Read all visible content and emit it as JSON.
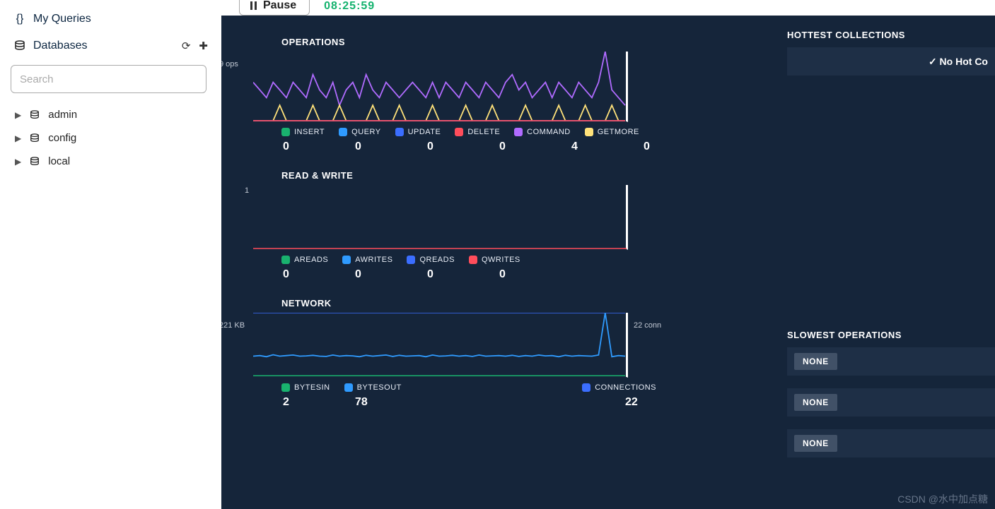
{
  "sidebar": {
    "my_queries": "My Queries",
    "databases": "Databases",
    "search_placeholder": "Search",
    "items": [
      "admin",
      "config",
      "local"
    ]
  },
  "toolbar": {
    "pause": "Pause",
    "timer": "08:25:59"
  },
  "colors": {
    "insert": "#19b26e",
    "query": "#2f9bff",
    "update": "#3b6eff",
    "delete": "#ff4d5b",
    "command": "#b06bff",
    "getmore": "#ffe27a",
    "areads": "#19b26e",
    "awrites": "#2f9bff",
    "qreads": "#3b6eff",
    "qwrites": "#ff4d5b",
    "bytesin": "#19b26e",
    "bytesout": "#2f9bff",
    "connections": "#3b6eff"
  },
  "charts": {
    "operations": {
      "title": "OPERATIONS",
      "y_label": "9 ops",
      "legend": [
        {
          "key": "insert",
          "label": "INSERT",
          "value": "0"
        },
        {
          "key": "query",
          "label": "QUERY",
          "value": "0"
        },
        {
          "key": "update",
          "label": "UPDATE",
          "value": "0"
        },
        {
          "key": "delete",
          "label": "DELETE",
          "value": "0"
        },
        {
          "key": "command",
          "label": "COMMAND",
          "value": "4"
        },
        {
          "key": "getmore",
          "label": "GETMORE",
          "value": "0"
        }
      ]
    },
    "readwrite": {
      "title": "READ & WRITE",
      "y_label": "1",
      "legend": [
        {
          "key": "areads",
          "label": "AREADS",
          "value": "0"
        },
        {
          "key": "awrites",
          "label": "AWRITES",
          "value": "0"
        },
        {
          "key": "qreads",
          "label": "QREADS",
          "value": "0"
        },
        {
          "key": "qwrites",
          "label": "QWRITES",
          "value": "0"
        }
      ]
    },
    "network": {
      "title": "NETWORK",
      "y_left": "221 KB",
      "y_right": "22 conn",
      "legend": [
        {
          "key": "bytesin",
          "label": "BYTESIN",
          "value": "2"
        },
        {
          "key": "bytesout",
          "label": "BYTESOUT",
          "value": "78"
        },
        {
          "key": "connections",
          "label": "CONNECTIONS",
          "value": "22"
        }
      ]
    }
  },
  "right": {
    "hottest_title": "HOTTEST COLLECTIONS",
    "no_hot": "✓ No Hot Co",
    "slowest_title": "SLOWEST OPERATIONS",
    "slow_items": [
      "NONE",
      "NONE",
      "NONE"
    ]
  },
  "watermark": "CSDN @水中加点糖",
  "chart_data": [
    {
      "type": "line",
      "title": "OPERATIONS",
      "ylabel": "ops",
      "ylim": [
        0,
        9
      ],
      "series": [
        {
          "name": "COMMAND",
          "values": [
            5,
            4,
            3,
            5,
            4,
            3,
            5,
            4,
            3,
            6,
            4,
            3,
            5,
            2,
            4,
            5,
            3,
            6,
            4,
            3,
            5,
            4,
            3,
            4,
            5,
            4,
            3,
            5,
            3,
            5,
            4,
            3,
            5,
            4,
            3,
            5,
            4,
            3,
            5,
            6,
            4,
            5,
            3,
            4,
            5,
            3,
            5,
            4,
            3,
            5,
            4,
            3,
            5,
            9,
            4,
            3,
            2
          ]
        },
        {
          "name": "GETMORE",
          "values": [
            0,
            0,
            0,
            0,
            1,
            0,
            0,
            0,
            0,
            1,
            0,
            0,
            0,
            1,
            0,
            0,
            0,
            0,
            1,
            0,
            0,
            0,
            1,
            0,
            0,
            0,
            0,
            1,
            0,
            0,
            0,
            0,
            1,
            0,
            0,
            0,
            1,
            0,
            0,
            0,
            0,
            1,
            0,
            0,
            0,
            0,
            1,
            0,
            0,
            0,
            1,
            0,
            0,
            0,
            1,
            0,
            0
          ]
        },
        {
          "name": "INSERT",
          "values": [
            0,
            0,
            0,
            0,
            0,
            0,
            0,
            0,
            0,
            0,
            0,
            0,
            0,
            0,
            0,
            0,
            0,
            0,
            0,
            0,
            0,
            0,
            0,
            0,
            0,
            0,
            0,
            0,
            0,
            0,
            0,
            0,
            0,
            0,
            0,
            0,
            0,
            0,
            0,
            0,
            0,
            0,
            0,
            0,
            0,
            0,
            0,
            0,
            0,
            0,
            0,
            0,
            0,
            0,
            0,
            0,
            0
          ]
        },
        {
          "name": "QUERY",
          "values": [
            0,
            0,
            0,
            0,
            0,
            0,
            0,
            0,
            0,
            0,
            0,
            0,
            0,
            0,
            0,
            0,
            0,
            0,
            0,
            0,
            0,
            0,
            0,
            0,
            0,
            0,
            0,
            0,
            0,
            0,
            0,
            0,
            0,
            0,
            0,
            0,
            0,
            0,
            0,
            0,
            0,
            0,
            0,
            0,
            0,
            0,
            0,
            0,
            0,
            0,
            0,
            0,
            0,
            0,
            0,
            0,
            0
          ]
        },
        {
          "name": "UPDATE",
          "values": [
            0,
            0,
            0,
            0,
            0,
            0,
            0,
            0,
            0,
            0,
            0,
            0,
            0,
            0,
            0,
            0,
            0,
            0,
            0,
            0,
            0,
            0,
            0,
            0,
            0,
            0,
            0,
            0,
            0,
            0,
            0,
            0,
            0,
            0,
            0,
            0,
            0,
            0,
            0,
            0,
            0,
            0,
            0,
            0,
            0,
            0,
            0,
            0,
            0,
            0,
            0,
            0,
            0,
            0,
            0,
            0,
            0
          ]
        },
        {
          "name": "DELETE",
          "values": [
            0,
            0,
            0,
            0,
            0,
            0,
            0,
            0,
            0,
            0,
            0,
            0,
            0,
            0,
            0,
            0,
            0,
            0,
            0,
            0,
            0,
            0,
            0,
            0,
            0,
            0,
            0,
            0,
            0,
            0,
            0,
            0,
            0,
            0,
            0,
            0,
            0,
            0,
            0,
            0,
            0,
            0,
            0,
            0,
            0,
            0,
            0,
            0,
            0,
            0,
            0,
            0,
            0,
            0,
            0,
            0,
            0
          ]
        }
      ]
    },
    {
      "type": "line",
      "title": "READ & WRITE",
      "ylabel": "",
      "ylim": [
        0,
        1
      ],
      "series": [
        {
          "name": "AREADS",
          "values": [
            0,
            0,
            0,
            0,
            0,
            0,
            0,
            0,
            0,
            0,
            0,
            0,
            0,
            0,
            0,
            0,
            0,
            0,
            0,
            0,
            0,
            0,
            0,
            0,
            0,
            0,
            0,
            0,
            0,
            0,
            0,
            0,
            0,
            0,
            0,
            0,
            0,
            0,
            0,
            0,
            0,
            0,
            0,
            0,
            0,
            0,
            0,
            0,
            0,
            0,
            0,
            0,
            0,
            0,
            0,
            0,
            0
          ]
        },
        {
          "name": "AWRITES",
          "values": [
            0,
            0,
            0,
            0,
            0,
            0,
            0,
            0,
            0,
            0,
            0,
            0,
            0,
            0,
            0,
            0,
            0,
            0,
            0,
            0,
            0,
            0,
            0,
            0,
            0,
            0,
            0,
            0,
            0,
            0,
            0,
            0,
            0,
            0,
            0,
            0,
            0,
            0,
            0,
            0,
            0,
            0,
            0,
            0,
            0,
            0,
            0,
            0,
            0,
            0,
            0,
            0,
            0,
            0,
            0,
            0,
            0
          ]
        },
        {
          "name": "QREADS",
          "values": [
            0,
            0,
            0,
            0,
            0,
            0,
            0,
            0,
            0,
            0,
            0,
            0,
            0,
            0,
            0,
            0,
            0,
            0,
            0,
            0,
            0,
            0,
            0,
            0,
            0,
            0,
            0,
            0,
            0,
            0,
            0,
            0,
            0,
            0,
            0,
            0,
            0,
            0,
            0,
            0,
            0,
            0,
            0,
            0,
            0,
            0,
            0,
            0,
            0,
            0,
            0,
            0,
            0,
            0,
            0,
            0,
            0
          ]
        },
        {
          "name": "QWRITES",
          "values": [
            0,
            0,
            0,
            0,
            0,
            0,
            0,
            0,
            0,
            0,
            0,
            0,
            0,
            0,
            0,
            0,
            0,
            0,
            0,
            0,
            0,
            0,
            0,
            0,
            0,
            0,
            0,
            0,
            0,
            0,
            0,
            0,
            0,
            0,
            0,
            0,
            0,
            0,
            0,
            0,
            0,
            0,
            0,
            0,
            0,
            0,
            0,
            0,
            0,
            0,
            0,
            0,
            0,
            0,
            0,
            0,
            0
          ]
        }
      ]
    },
    {
      "type": "line",
      "title": "NETWORK",
      "ylabel_left": "KB",
      "ylabel_right": "conn",
      "ylim_left": [
        0,
        221
      ],
      "ylim_right": [
        0,
        22
      ],
      "series": [
        {
          "name": "BYTESIN",
          "values": [
            2,
            2,
            2,
            2,
            2,
            2,
            2,
            2,
            2,
            2,
            2,
            2,
            2,
            2,
            2,
            2,
            2,
            2,
            2,
            2,
            2,
            2,
            2,
            2,
            2,
            2,
            2,
            2,
            2,
            2,
            2,
            2,
            2,
            2,
            2,
            2,
            2,
            2,
            2,
            2,
            2,
            2,
            2,
            2,
            2,
            2,
            2,
            2,
            2,
            2,
            2,
            2,
            2,
            2,
            2,
            2,
            2
          ]
        },
        {
          "name": "BYTESOUT",
          "values": [
            70,
            72,
            68,
            75,
            70,
            72,
            74,
            70,
            71,
            73,
            70,
            69,
            74,
            70,
            72,
            71,
            68,
            73,
            70,
            72,
            74,
            69,
            73,
            70,
            71,
            72,
            68,
            74,
            70,
            71,
            73,
            70,
            72,
            69,
            74,
            70,
            71,
            72,
            70,
            73,
            69,
            72,
            70,
            74,
            71,
            72,
            68,
            73,
            70,
            72,
            71,
            70,
            74,
            221,
            68,
            72,
            70
          ]
        },
        {
          "name": "CONNECTIONS",
          "values": [
            22,
            22,
            22,
            22,
            22,
            22,
            22,
            22,
            22,
            22,
            22,
            22,
            22,
            22,
            22,
            22,
            22,
            22,
            22,
            22,
            22,
            22,
            22,
            22,
            22,
            22,
            22,
            22,
            22,
            22,
            22,
            22,
            22,
            22,
            22,
            22,
            22,
            22,
            22,
            22,
            22,
            22,
            22,
            22,
            22,
            22,
            22,
            22,
            22,
            22,
            22,
            22,
            22,
            22,
            22,
            22,
            22
          ]
        }
      ]
    }
  ]
}
